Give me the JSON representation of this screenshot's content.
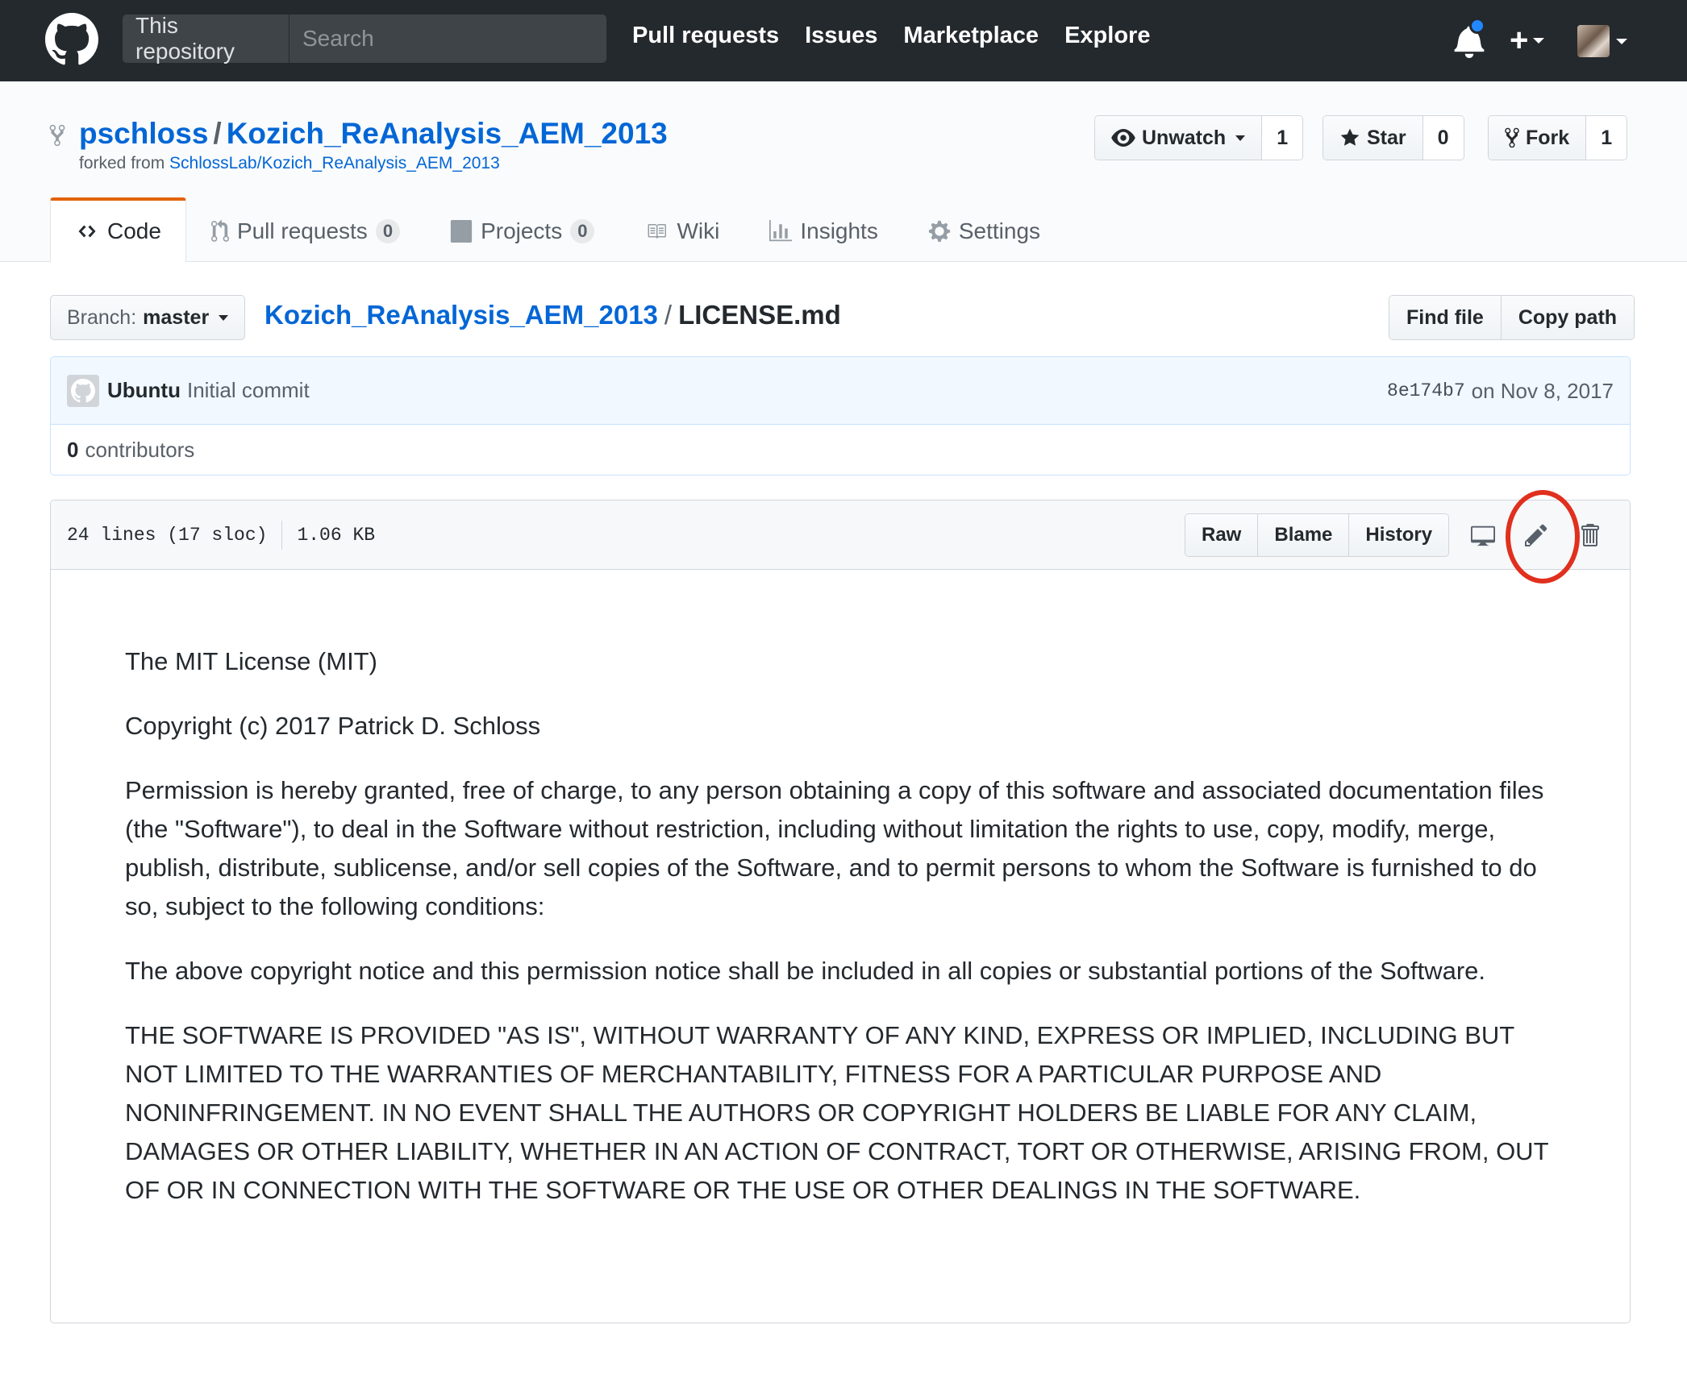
{
  "header": {
    "scope_label": "This repository",
    "search_placeholder": "Search",
    "nav": [
      "Pull requests",
      "Issues",
      "Marketplace",
      "Explore"
    ],
    "plus_label": "+",
    "notification_dot_color": "#2188ff"
  },
  "repo": {
    "owner": "pschloss",
    "separator": "/",
    "name": "Kozich_ReAnalysis_AEM_2013",
    "forked_from_label": "forked from",
    "forked_from_link": "SchlossLab/Kozich_ReAnalysis_AEM_2013"
  },
  "actions": {
    "watch_label": "Unwatch",
    "watch_count": "1",
    "star_label": "Star",
    "star_count": "0",
    "fork_label": "Fork",
    "fork_count": "1"
  },
  "tabs": {
    "code": "Code",
    "pulls": "Pull requests",
    "pulls_count": "0",
    "projects": "Projects",
    "projects_count": "0",
    "wiki": "Wiki",
    "insights": "Insights",
    "settings": "Settings",
    "selected_accent": "#e36209"
  },
  "file_nav": {
    "branch_prefix": "Branch:",
    "branch_name": "master",
    "breadcrumb_root": "Kozich_ReAnalysis_AEM_2013",
    "breadcrumb_sep": "/",
    "breadcrumb_file": "LICENSE.md",
    "find_file": "Find file",
    "copy_path": "Copy path"
  },
  "commit": {
    "author": "Ubuntu",
    "message": "Initial commit",
    "sha": "8e174b7",
    "date": "on Nov 8, 2017",
    "contributors_count": "0",
    "contributors_label": "contributors"
  },
  "file": {
    "lines": "24 lines (17 sloc)",
    "size": "1.06 KB",
    "raw": "Raw",
    "blame": "Blame",
    "history": "History",
    "annotation_color": "#e0301e"
  },
  "content": {
    "p1": "The MIT License (MIT)",
    "p2": "Copyright (c) 2017 Patrick D. Schloss",
    "p3": "Permission is hereby granted, free of charge, to any person obtaining a copy of this software and associated documentation files (the \"Software\"), to deal in the Software without restriction, including without limitation the rights to use, copy, modify, merge, publish, distribute, sublicense, and/or sell copies of the Software, and to permit persons to whom the Software is furnished to do so, subject to the following conditions:",
    "p4": "The above copyright notice and this permission notice shall be included in all copies or substantial portions of the Software.",
    "p5": "THE SOFTWARE IS PROVIDED \"AS IS\", WITHOUT WARRANTY OF ANY KIND, EXPRESS OR IMPLIED, INCLUDING BUT NOT LIMITED TO THE WARRANTIES OF MERCHANTABILITY, FITNESS FOR A PARTICULAR PURPOSE AND NONINFRINGEMENT. IN NO EVENT SHALL THE AUTHORS OR COPYRIGHT HOLDERS BE LIABLE FOR ANY CLAIM, DAMAGES OR OTHER LIABILITY, WHETHER IN AN ACTION OF CONTRACT, TORT OR OTHERWISE, ARISING FROM, OUT OF OR IN CONNECTION WITH THE SOFTWARE OR THE USE OR OTHER DEALINGS IN THE SOFTWARE."
  },
  "icons": {
    "logo": "github-mark-icon",
    "notifications": "bell-icon",
    "avatar": "avatar",
    "watch": "eye-icon",
    "star": "star-icon",
    "fork": "repo-forked-icon",
    "code": "code-icon",
    "pulls": "git-pull-request-icon",
    "projects": "project-icon",
    "wiki": "book-icon",
    "insights": "graph-icon",
    "settings": "gear-icon",
    "desktop": "device-desktop-icon",
    "edit": "pencil-icon",
    "delete": "trashcan-icon"
  }
}
